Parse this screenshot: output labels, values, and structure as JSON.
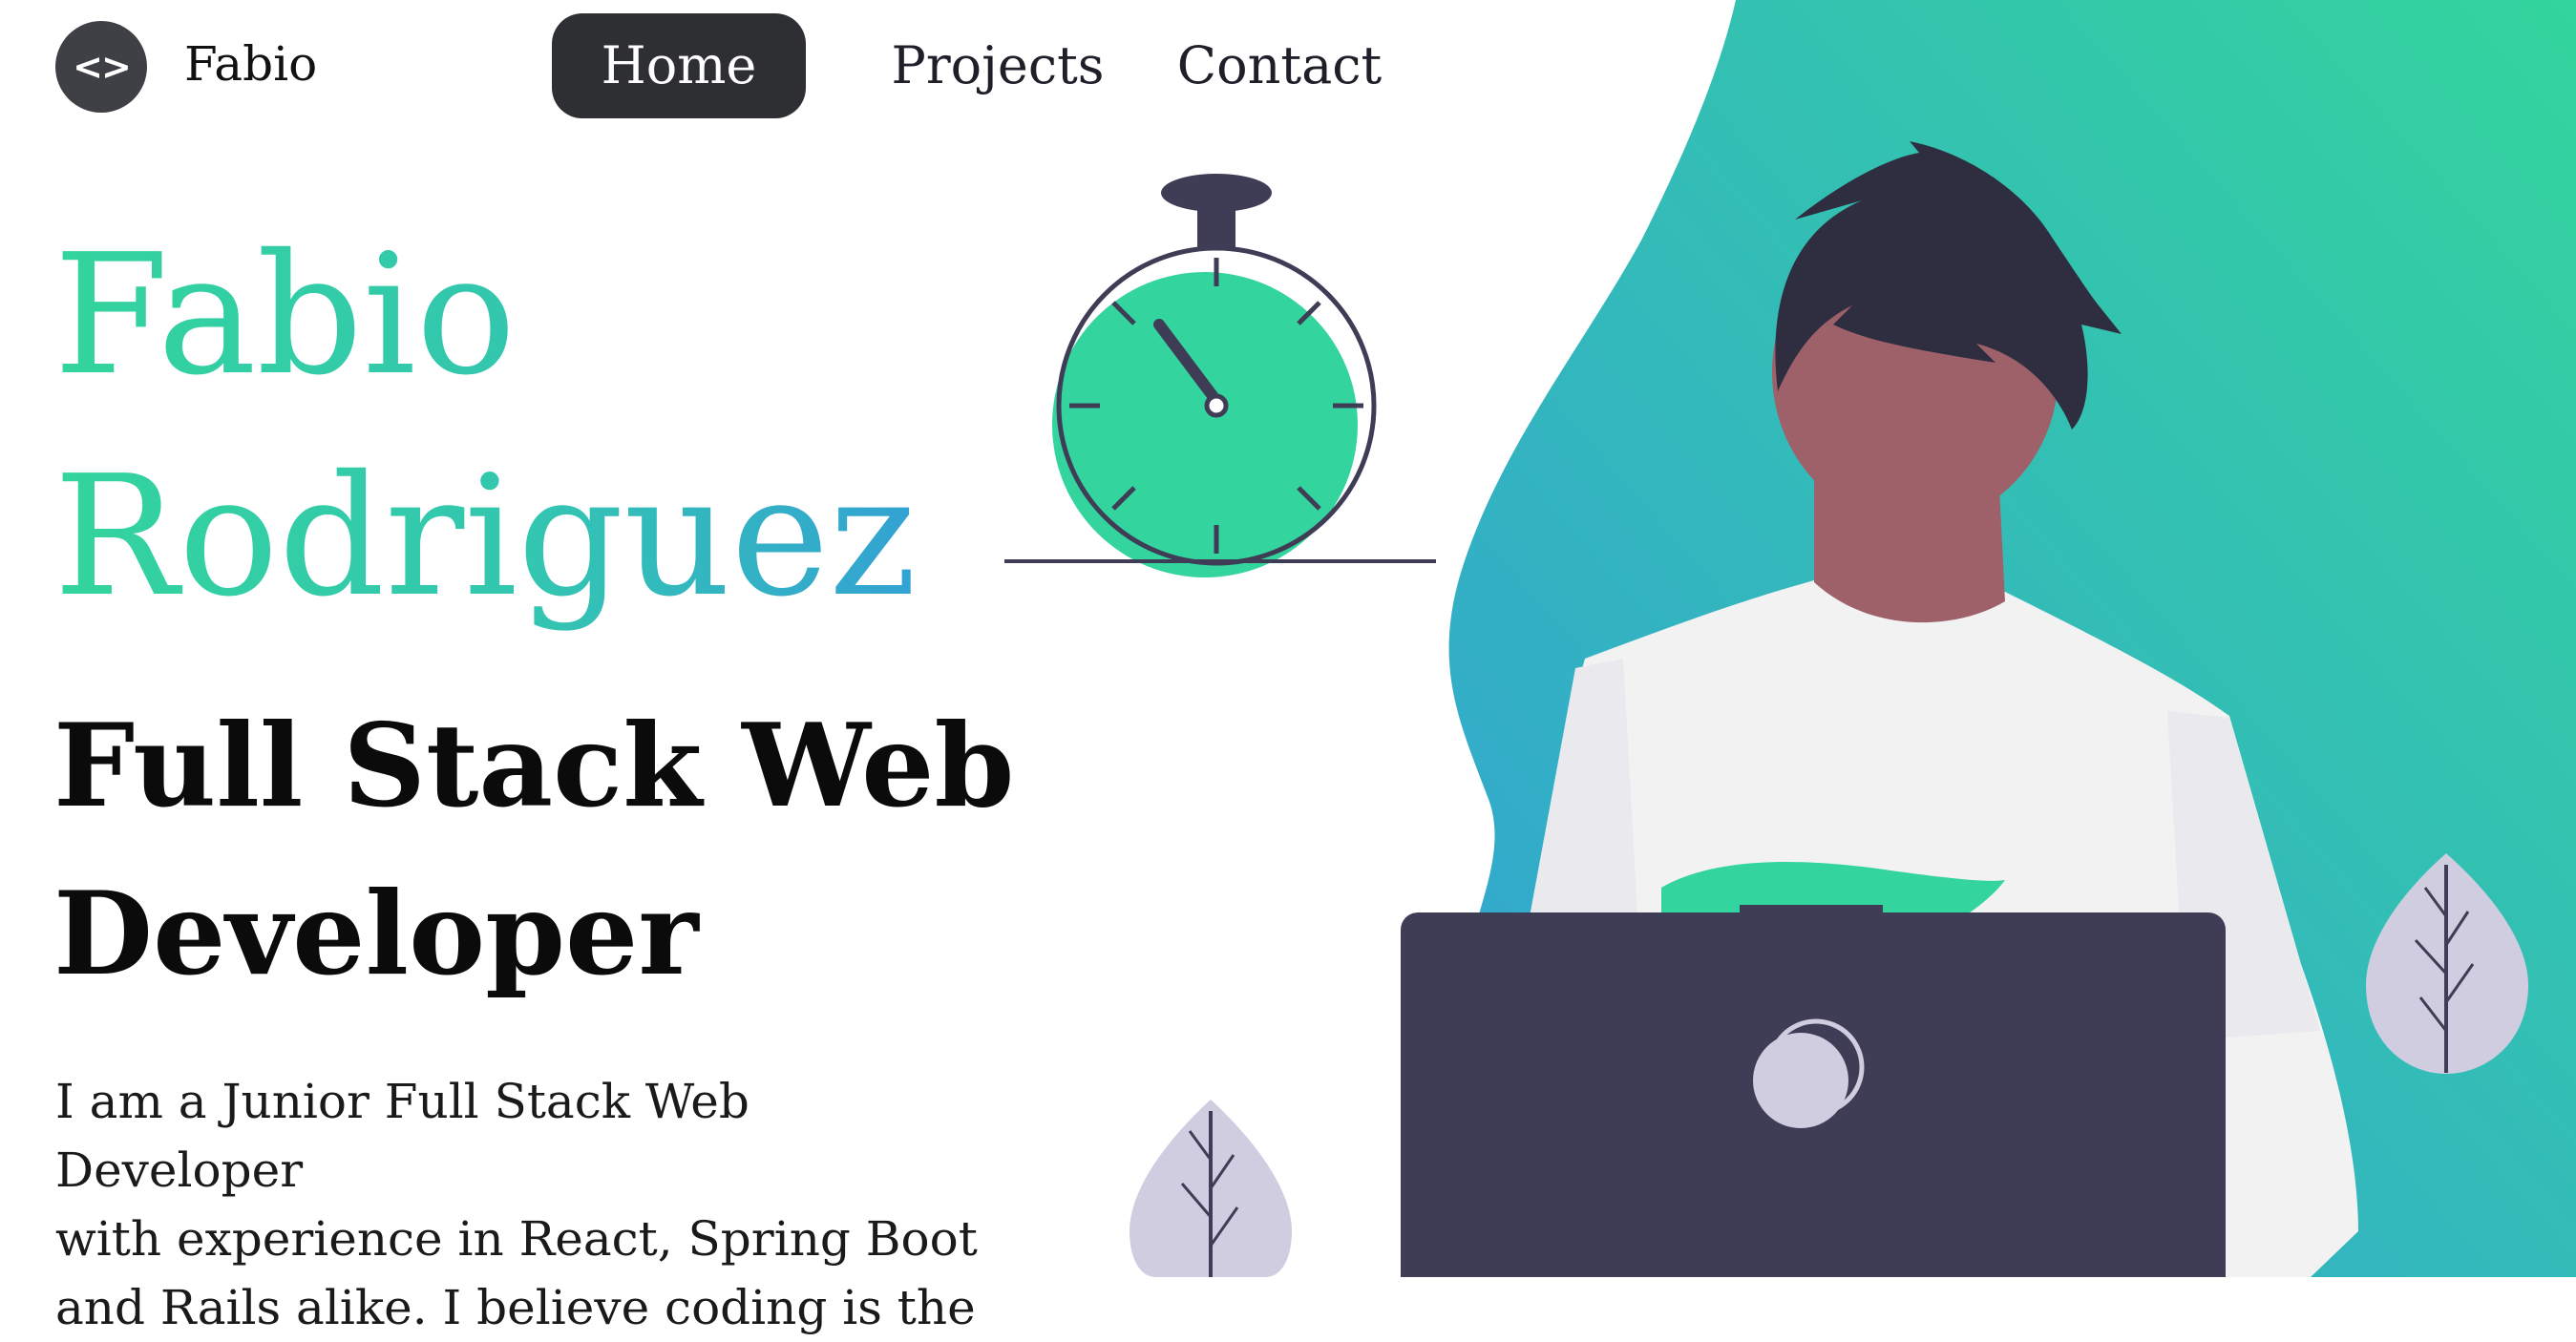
{
  "nav": {
    "logo_glyph": "<>",
    "brand": "Fabio",
    "links": [
      {
        "label": "Home",
        "active": true
      },
      {
        "label": "Projects",
        "active": false
      },
      {
        "label": "Contact",
        "active": false
      }
    ]
  },
  "hero": {
    "name_line1": "Fabio",
    "name_line2": "Rodriguez",
    "role_line1": "Full Stack Web",
    "role_line2": "Developer",
    "bio_line1": "I am a Junior Full Stack Web Developer",
    "bio_line2": "with experience in React, Spring Boot",
    "bio_line3": "and Rails alike. I believe coding is the"
  },
  "colors": {
    "accent_green": "#33d49d",
    "accent_blue": "#33a2d4",
    "nav_active_bg": "#2e2f33",
    "illustration_dark": "#3f3d56",
    "leaf": "#d0cde1"
  },
  "illustration": {
    "items": [
      "stopwatch-icon",
      "developer-figure",
      "laptop-icon",
      "leaf-icon"
    ]
  }
}
